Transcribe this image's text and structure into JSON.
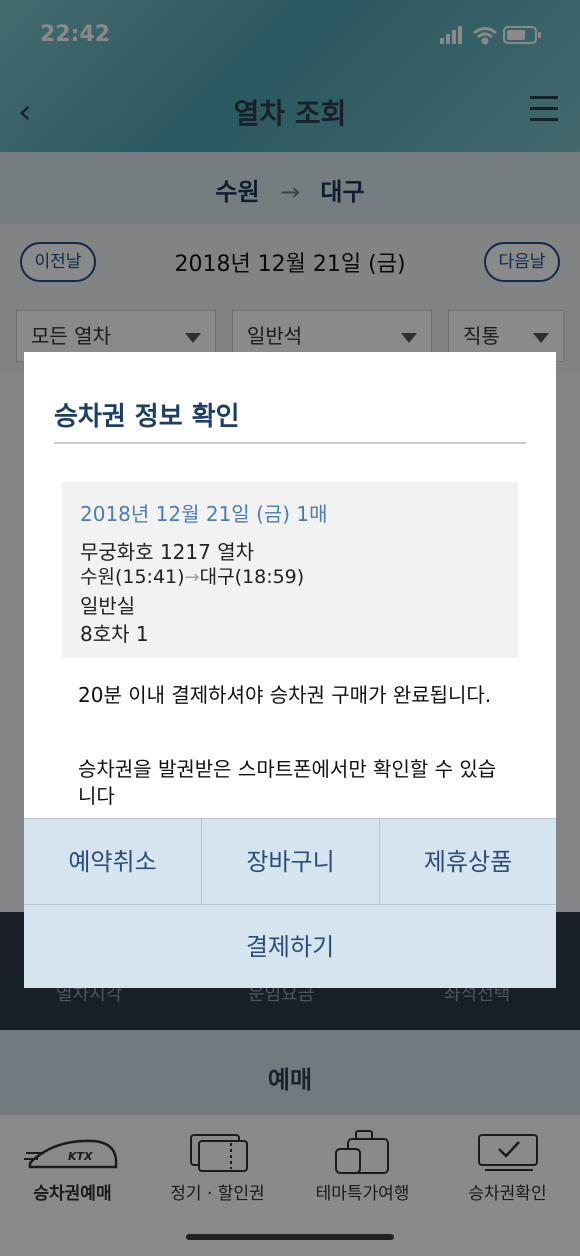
{
  "status": {
    "time": "22:42"
  },
  "header": {
    "title": "열차 조회"
  },
  "route": {
    "from": "수원",
    "arrow": "→",
    "to": "대구"
  },
  "date_nav": {
    "prev": "이전날",
    "date": "2018년 12월 21일 (금)",
    "next": "다음날"
  },
  "filters": {
    "train_type": "모든 열차",
    "seat_class": "일반석",
    "direct": "직통"
  },
  "background_bottom": {
    "col1": "열차시각",
    "col2": "운임요금",
    "col3": "좌석선택",
    "reserve": "예매"
  },
  "tabs": [
    {
      "label": "승차권예매",
      "icon": "ktx-train-icon"
    },
    {
      "label": "정기 · 할인권",
      "icon": "tickets-icon"
    },
    {
      "label": "테마특가여행",
      "icon": "luggage-icon"
    },
    {
      "label": "승차권확인",
      "icon": "ticket-check-icon"
    }
  ],
  "modal": {
    "title": "승차권 정보 확인",
    "info": {
      "date_line": "2018년 12월 21일 (금) 1매",
      "train": "무궁화호 1217 열차",
      "depart": "수원(15:41)",
      "arrow": "→",
      "arrive": "대구(18:59)",
      "car_class": "일반실",
      "seat": "8호차 1"
    },
    "notice1": "20분 이내 결제하셔야 승차권 구매가 완료됩니다.",
    "notice2": "승차권을 발권받은 스마트폰에서만 확인할 수 있습니다",
    "buttons": {
      "cancel": "예약취소",
      "cart": "장바구니",
      "partner": "제휴상품",
      "pay": "결제하기"
    }
  },
  "colors": {
    "accent": "#1f4e8c",
    "modal_button_bg": "#d6e4ef"
  }
}
